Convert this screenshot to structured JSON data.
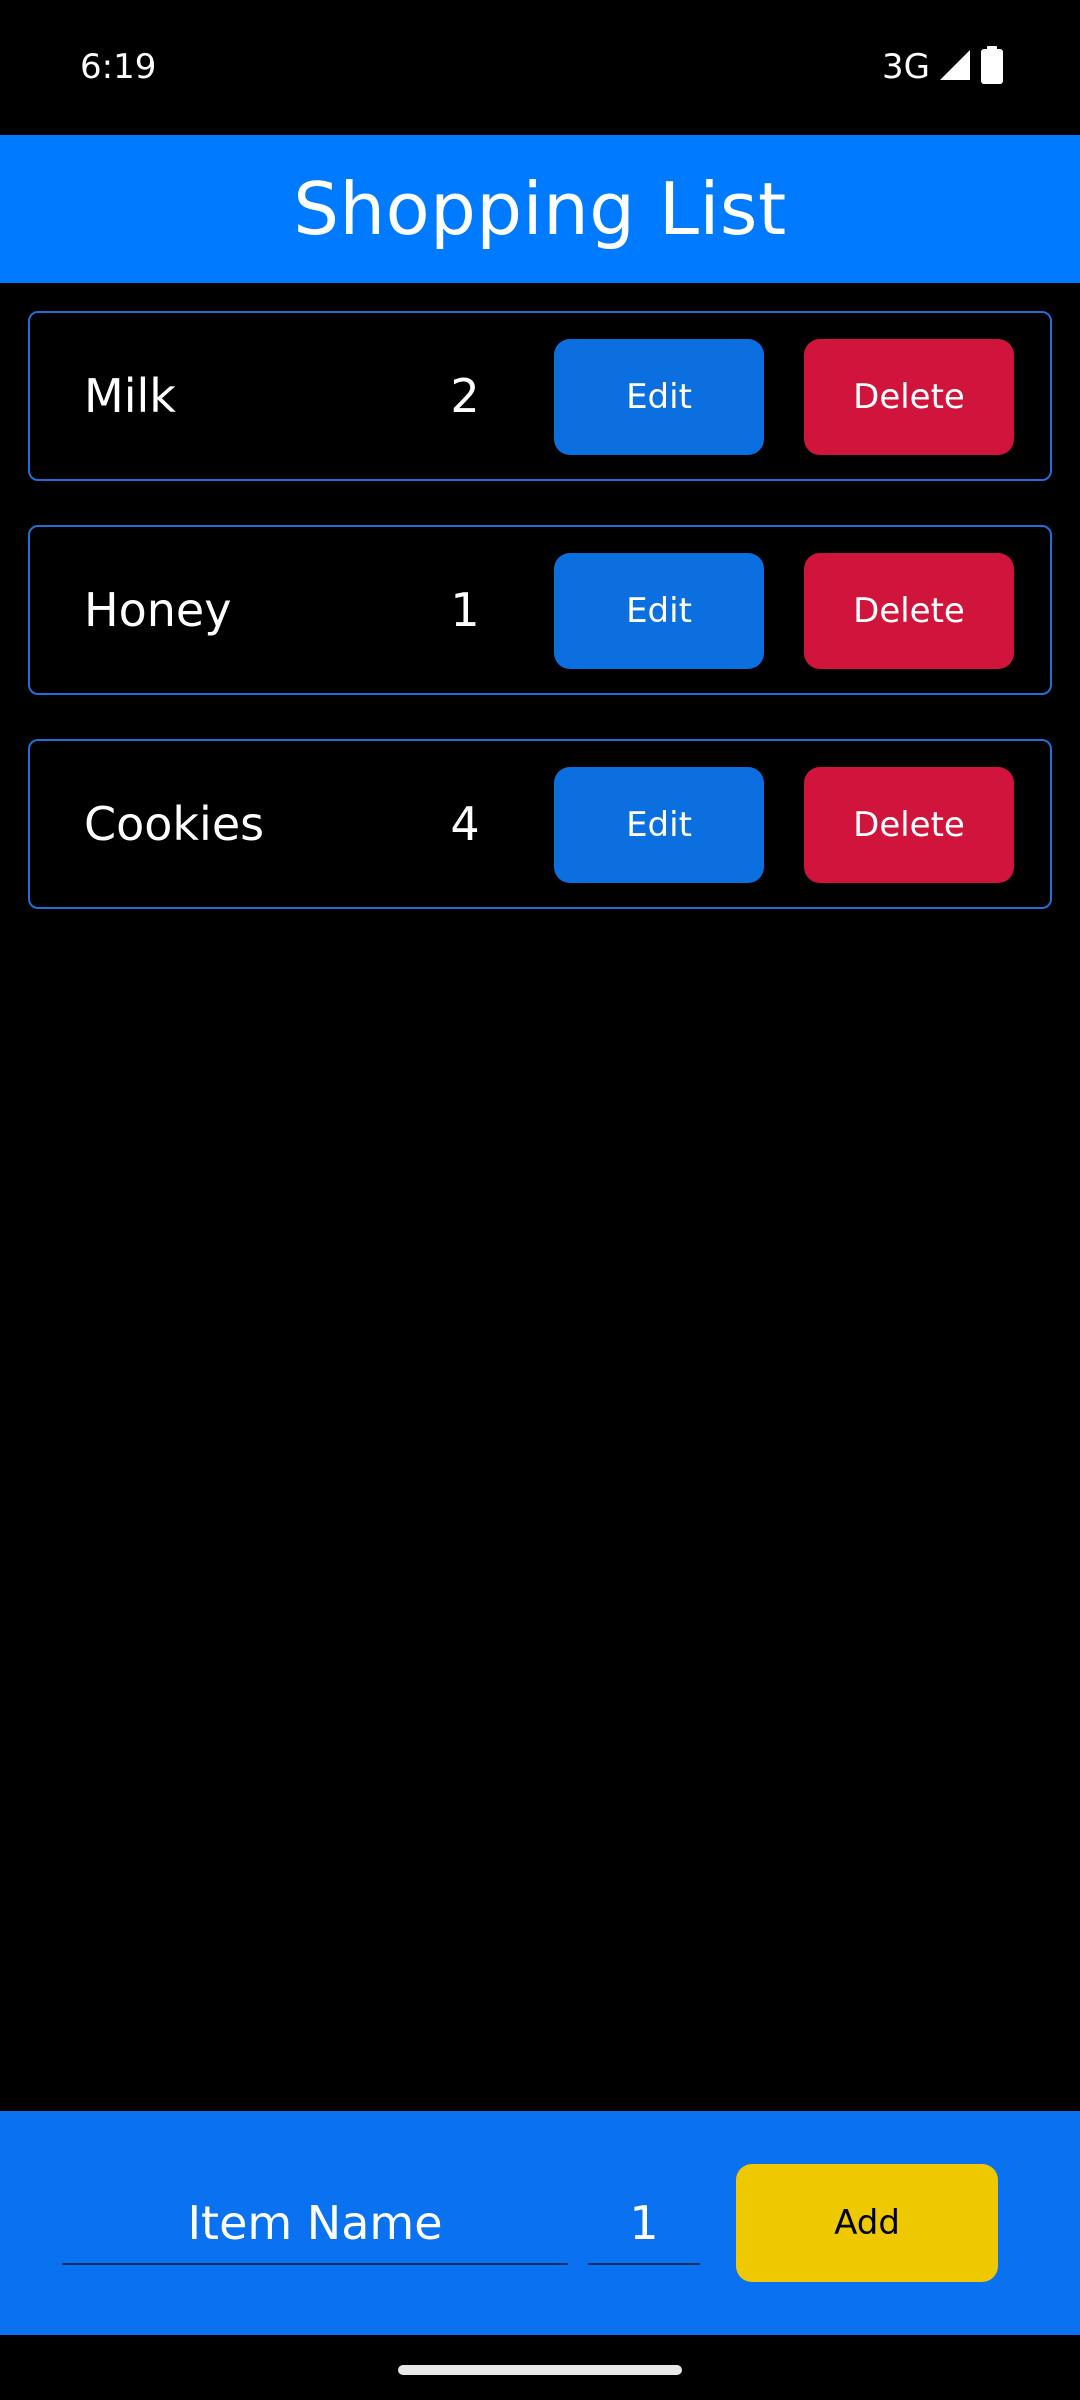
{
  "status_bar": {
    "time": "6:19",
    "network": "3G",
    "signal_icon": "cellular-signal-icon",
    "battery_icon": "battery-icon"
  },
  "app_bar": {
    "title": "Shopping List"
  },
  "items": [
    {
      "name": "Milk",
      "quantity": "2",
      "edit_label": "Edit",
      "delete_label": "Delete"
    },
    {
      "name": "Honey",
      "quantity": "1",
      "edit_label": "Edit",
      "delete_label": "Delete"
    },
    {
      "name": "Cookies",
      "quantity": "4",
      "edit_label": "Edit",
      "delete_label": "Delete"
    }
  ],
  "add_form": {
    "name_placeholder": "Item Name",
    "quantity_value": "1",
    "add_label": "Add"
  },
  "colors": {
    "app_bar": "#007bff",
    "edit_button": "#0b6fe0",
    "delete_button": "#d1143c",
    "add_button": "#eec800",
    "card_border": "#1f6fd8"
  }
}
